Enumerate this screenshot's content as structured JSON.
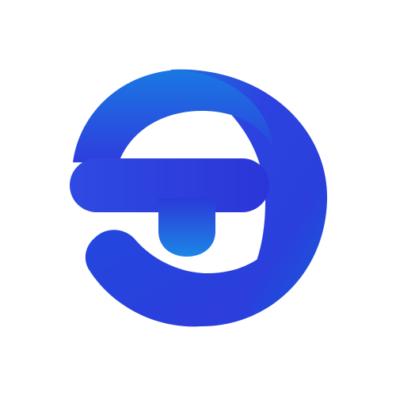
{
  "logo": {
    "icon": "letter-s-circle-logo-icon",
    "colors": {
      "background": "#ffffff",
      "primary_blue": "#2f49e0",
      "light_blue": "#1a7ae0",
      "deep_blue": "#2a3ad8"
    }
  }
}
